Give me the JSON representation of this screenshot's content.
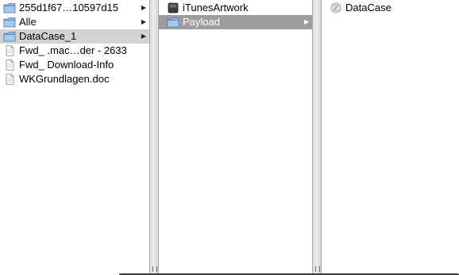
{
  "columns": [
    {
      "items": [
        {
          "label": "255d1f67…10597d15",
          "icon": "folder-icon",
          "has_children": true
        },
        {
          "label": "Alle",
          "icon": "folder-icon",
          "has_children": true
        },
        {
          "label": "DataCase_1",
          "icon": "folder-icon",
          "has_children": true,
          "selected": "inactive"
        },
        {
          "label": "Fwd_ .mac…der - 2633",
          "icon": "document-icon",
          "has_children": false
        },
        {
          "label": "Fwd_ Download-Info",
          "icon": "document-icon",
          "has_children": false
        },
        {
          "label": "WKGrundlagen.doc",
          "icon": "document-icon",
          "has_children": false
        }
      ]
    },
    {
      "items": [
        {
          "label": "iTunesArtwork",
          "icon": "image-file-icon",
          "has_children": false
        },
        {
          "label": "Payload",
          "icon": "folder-icon",
          "has_children": true,
          "selected": "active"
        }
      ]
    },
    {
      "items": [
        {
          "label": "DataCase",
          "icon": "application-icon",
          "has_children": false
        }
      ]
    }
  ],
  "arrow_glyph": "▶",
  "resize_grip_glyph": "||",
  "colors": {
    "folder": "#7aa7d8",
    "selection_inactive": "#d3d3d3",
    "selection_active": "#9d9d9d"
  }
}
